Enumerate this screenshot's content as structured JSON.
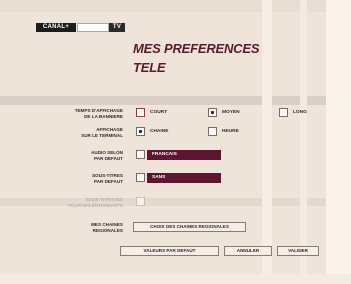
{
  "logo": {
    "part1": "CANAL+",
    "part2": "",
    "part3": "TV"
  },
  "title": {
    "line1": "MES PREFERENCES",
    "line2": "TELE"
  },
  "rows": [
    {
      "label_l1": "TEMPS D'AFFICHAGE",
      "label_l2": "DE LA BANNIERE",
      "options": [
        "COURT",
        "MOYEN",
        "LONG"
      ],
      "selected": "MOYEN"
    },
    {
      "label_l1": "AFFICHAGE",
      "label_l2": "SUR LE TERMINAL",
      "options": [
        "CHAINE",
        "HEURE"
      ],
      "selected": "CHAINE"
    },
    {
      "label_l1": "AUDIO SELON",
      "label_l2": "PAR DEFAUT",
      "value": "FRANCAIS"
    },
    {
      "label_l1": "SOUS-TITRES",
      "label_l2": "PAR DEFAUT",
      "value": "SANS"
    },
    {
      "label_l1": "SOUS-TITRAGES",
      "label_l2": "POUR MALENTENDANTS"
    },
    {
      "label_l1": "MES CHAINES",
      "label_l2": "REGIONALES",
      "button": "CHOIX DES CHAINES REGIONALES"
    }
  ],
  "footer": {
    "default": "VALEURS PAR DEFAUT",
    "cancel": "ANNULER",
    "validate": "VALIDER"
  }
}
